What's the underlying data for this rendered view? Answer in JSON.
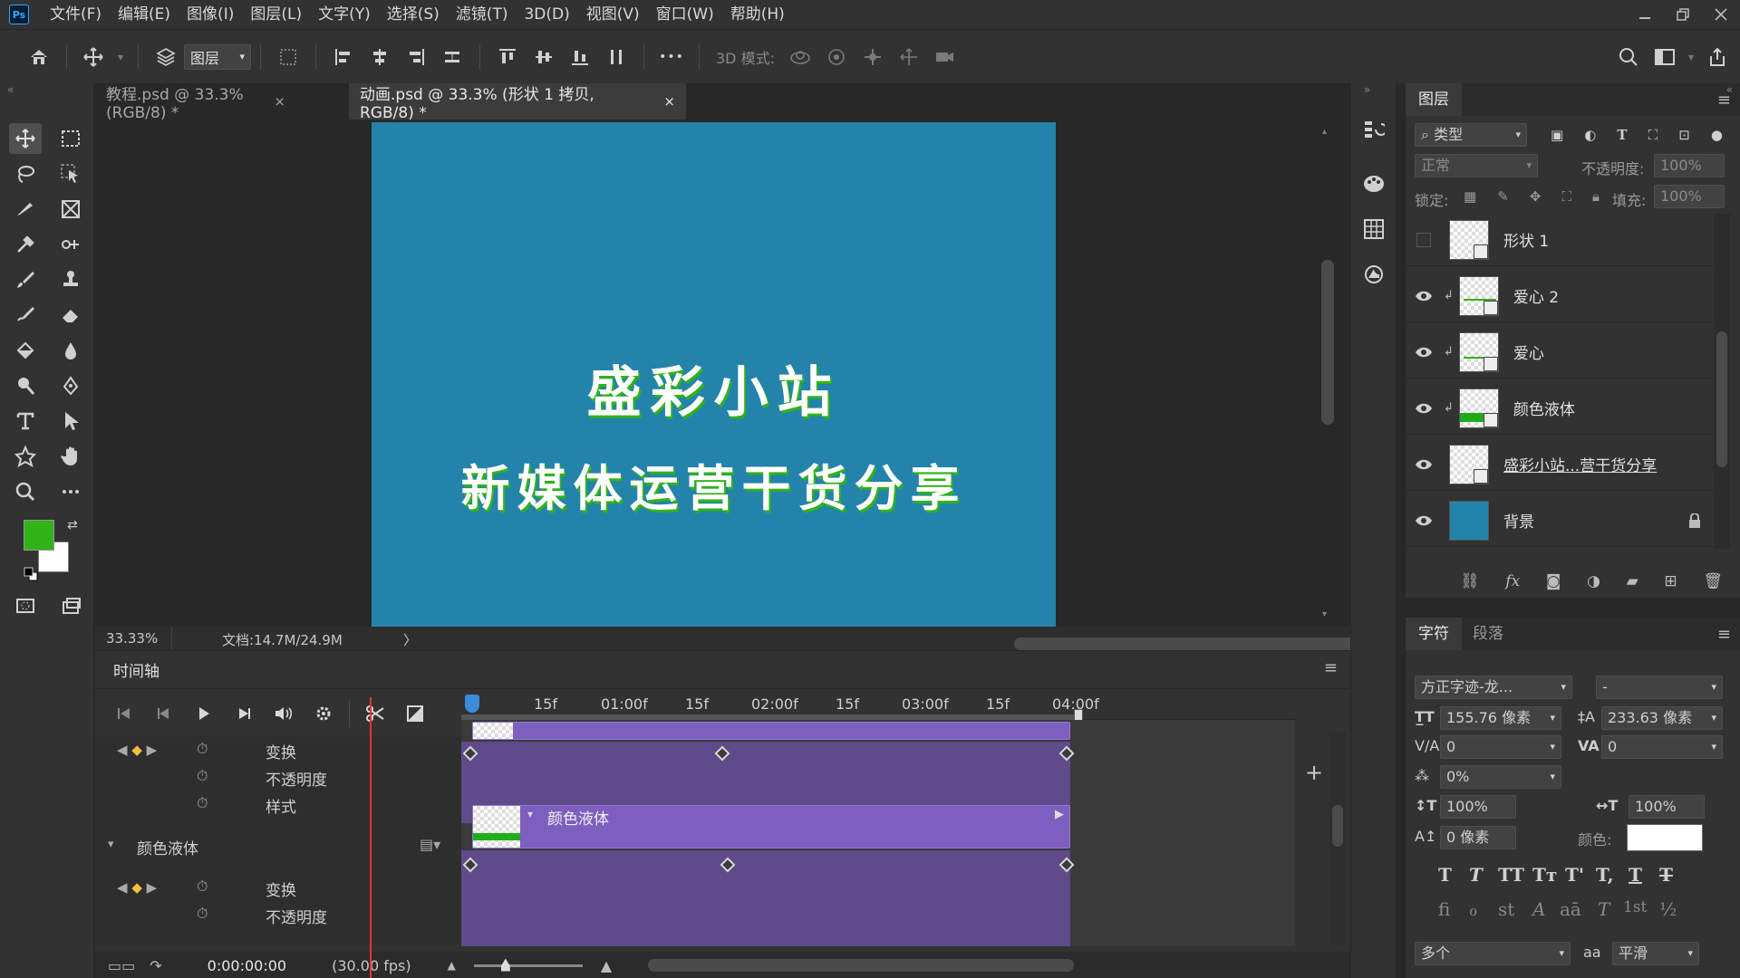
{
  "app": {
    "logo": "Ps"
  },
  "menu": [
    "文件(F)",
    "编辑(E)",
    "图像(I)",
    "图层(L)",
    "文字(Y)",
    "选择(S)",
    "滤镜(T)",
    "3D(D)",
    "视图(V)",
    "窗口(W)",
    "帮助(H)"
  ],
  "options": {
    "auto_select_value": "图层",
    "mode3d_label": "3D 模式:",
    "more": "•••"
  },
  "tabs": [
    {
      "label": "教程.psd @ 33.3%(RGB/8) *",
      "close": "×"
    },
    {
      "label": "动画.psd @ 33.3% (形状 1 拷贝, RGB/8) *",
      "close": "×"
    }
  ],
  "canvas": {
    "line1": "盛彩小站",
    "line2": "新媒体运营干货分享",
    "bg_color": "#2483aa",
    "accent_color": "#2fb318"
  },
  "status": {
    "zoom": "33.33%",
    "doc": "文档:14.7M/24.9M",
    "arrow": "〉"
  },
  "timeline": {
    "title": "时间轴",
    "ruler": [
      "15f",
      "01:00f",
      "15f",
      "02:00f",
      "15f",
      "03:00f",
      "15f",
      "04:00f"
    ],
    "rows": [
      "变换",
      "不透明度",
      "样式",
      "颜色液体",
      "变换",
      "不透明度"
    ],
    "clip_label": "颜色液体",
    "current_time": "0:00:00:00",
    "fps": "(30.00 fps)",
    "add_label": "+"
  },
  "layers_panel": {
    "tab": "图层",
    "filter_value": "类型",
    "blend_value": "正常",
    "opacity_label": "不透明度:",
    "opacity_value": "100%",
    "lock_label": "锁定:",
    "fill_label": "填充:",
    "fill_value": "100%",
    "layers": [
      {
        "name": "形状 1",
        "visible": false
      },
      {
        "name": "爱心 2",
        "visible": true
      },
      {
        "name": "爱心",
        "visible": true
      },
      {
        "name": "颜色液体",
        "visible": true
      },
      {
        "name": "盛彩小站...营干货分享",
        "visible": true
      },
      {
        "name": "背景",
        "visible": true
      }
    ],
    "fx_label": "fx"
  },
  "character_panel": {
    "tabs": [
      "字符",
      "段落"
    ],
    "font_family": "方正字迹-龙...",
    "font_style": "-",
    "font_size": "155.76 像素",
    "leading": "233.63 像素",
    "kerning": "0",
    "tracking": "0",
    "scale_percent": "0%",
    "vertical_scale": "100%",
    "horizontal_scale": "100%",
    "baseline": "0 像素",
    "color_label": "颜色:",
    "text_color": "#ffffff",
    "styles": [
      "T",
      "T",
      "TT",
      "Tт",
      "T'",
      "T,",
      "T",
      "T"
    ],
    "opentype": [
      "fi",
      "ℴ",
      "st",
      "A",
      "aā",
      "T",
      "1st",
      "½"
    ],
    "language": "多个",
    "aa_label": "aa",
    "antialias": "平滑"
  },
  "colors": {
    "foreground": "#2fb318",
    "background": "#ffffff"
  }
}
